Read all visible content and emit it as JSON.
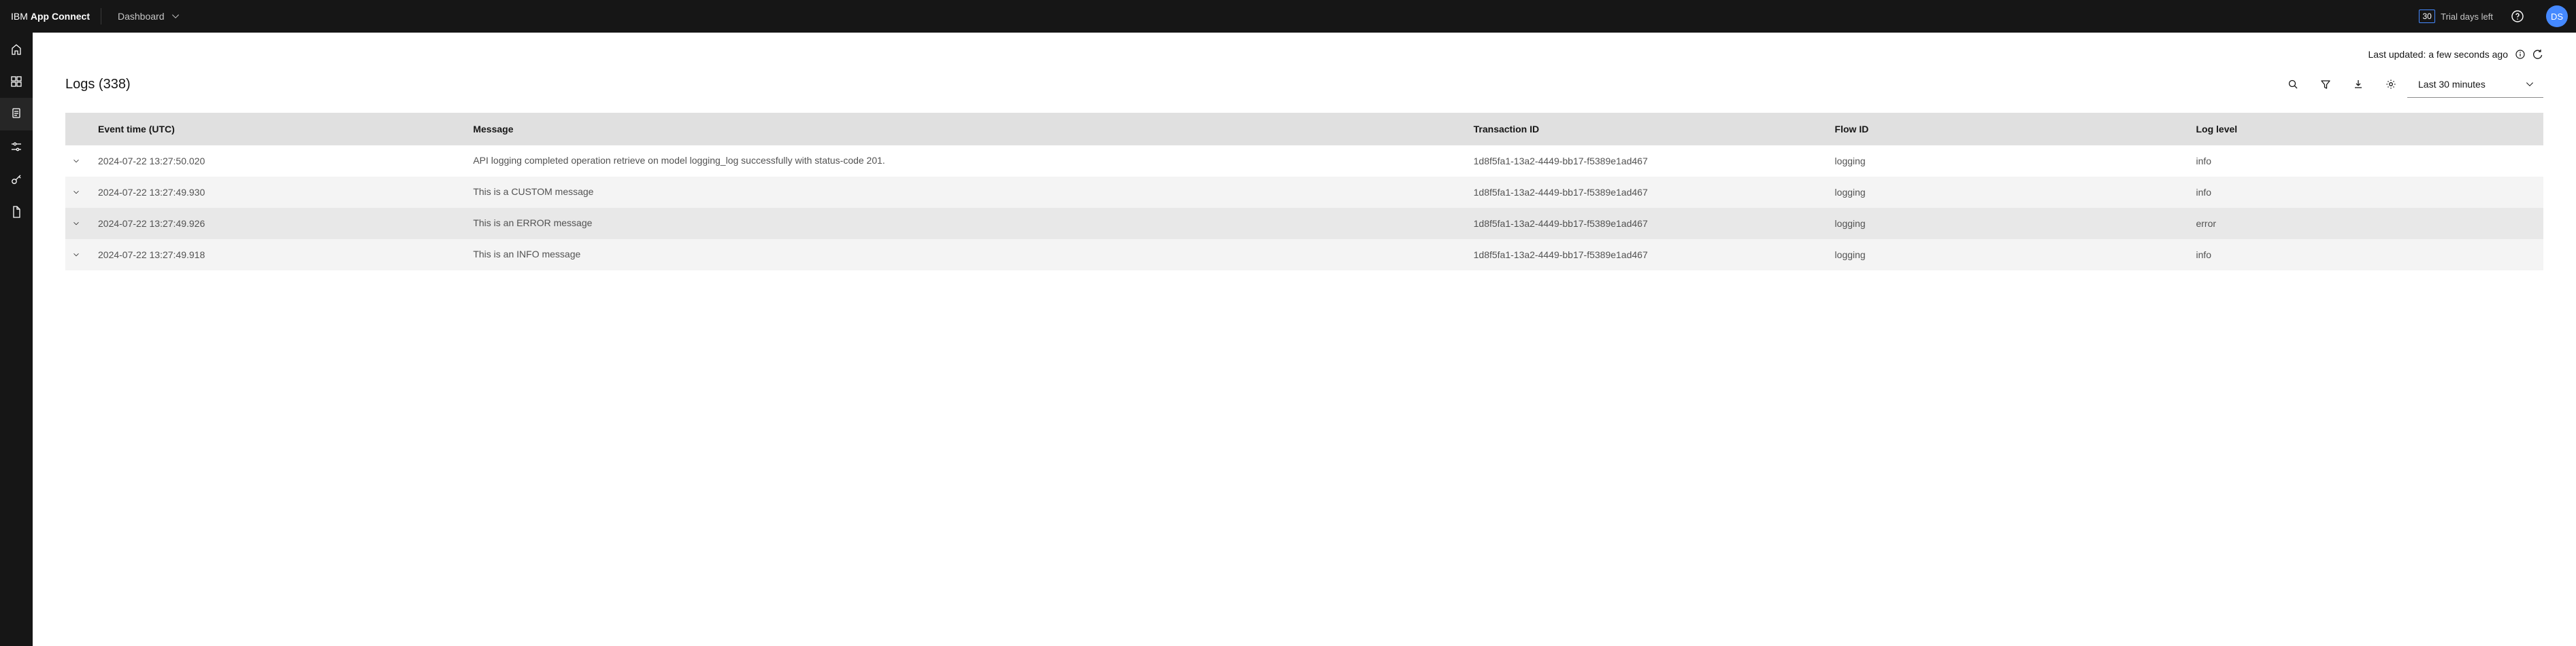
{
  "header": {
    "brand_prefix": "IBM",
    "brand_name": "App Connect",
    "breadcrumb": "Dashboard",
    "trial_days": "30",
    "trial_label": "Trial days left",
    "avatar": "DS"
  },
  "updated": {
    "prefix": "Last updated: ",
    "value": "a few seconds ago"
  },
  "page": {
    "title": "Logs (338)",
    "timerange": "Last 30 minutes"
  },
  "columns": {
    "time": "Event time (UTC)",
    "message": "Message",
    "txn": "Transaction ID",
    "flow": "Flow ID",
    "level": "Log level"
  },
  "rows": [
    {
      "time": "2024-07-22 13:27:50.020",
      "message": "API logging completed operation retrieve on model logging_log successfully with status-code 201.",
      "txn": "1d8f5fa1-13a2-4449-bb17-f5389e1ad467",
      "flow": "logging",
      "level": "info"
    },
    {
      "time": "2024-07-22 13:27:49.930",
      "message": "This is a CUSTOM message",
      "txn": "1d8f5fa1-13a2-4449-bb17-f5389e1ad467",
      "flow": "logging",
      "level": "info"
    },
    {
      "time": "2024-07-22 13:27:49.926",
      "message": "This is an ERROR message",
      "txn": "1d8f5fa1-13a2-4449-bb17-f5389e1ad467",
      "flow": "logging",
      "level": "error"
    },
    {
      "time": "2024-07-22 13:27:49.918",
      "message": "This is an INFO message",
      "txn": "1d8f5fa1-13a2-4449-bb17-f5389e1ad467",
      "flow": "logging",
      "level": "info"
    }
  ]
}
